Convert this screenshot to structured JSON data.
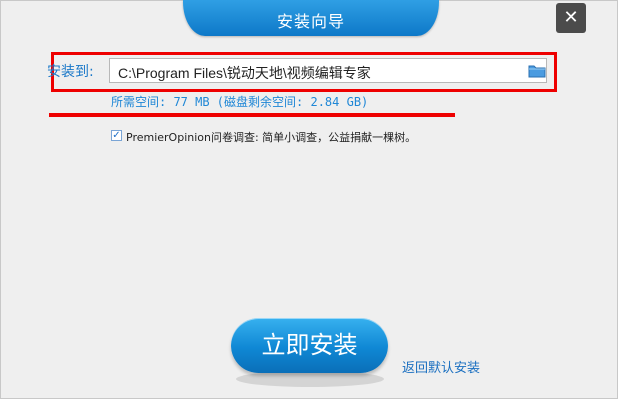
{
  "window": {
    "title": "安装向导",
    "close_label": "✕"
  },
  "install_path": {
    "label": "安装到:",
    "value": "C:\\Program Files\\锐动天地\\视频编辑专家",
    "browse_icon": "folder-icon"
  },
  "space_info": "所需空间: 77 MB (磁盘剩余空间: 2.84 GB)",
  "survey": {
    "checked": true,
    "check_mark": "✓",
    "text": "PremierOpinion问卷调查: 简单小调查，公益捐献一棵树。"
  },
  "actions": {
    "install_label": "立即安装",
    "back_label": "返回默认安装"
  },
  "colors": {
    "accent_blue": "#1a78c8",
    "highlight_red": "#ee0000",
    "background": "#efefef"
  }
}
